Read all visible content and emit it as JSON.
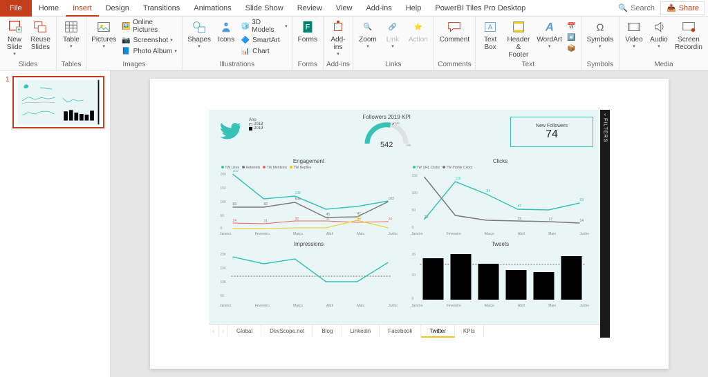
{
  "tabs": {
    "file": "File",
    "items": [
      "Home",
      "Insert",
      "Design",
      "Transitions",
      "Animations",
      "Slide Show",
      "Review",
      "View",
      "Add-ins",
      "Help",
      "PowerBI Tiles Pro Desktop"
    ],
    "active": "Insert",
    "search_placeholder": "Search",
    "share": "Share"
  },
  "ribbon": {
    "slides": {
      "label": "Slides",
      "new_slide": "New\nSlide",
      "reuse": "Reuse\nSlides"
    },
    "tables": {
      "label": "Tables",
      "table": "Table"
    },
    "images": {
      "label": "Images",
      "pictures": "Pictures",
      "online": "Online Pictures",
      "screenshot": "Screenshot",
      "photo_album": "Photo Album"
    },
    "illustrations": {
      "label": "Illustrations",
      "shapes": "Shapes",
      "icons": "Icons",
      "models": "3D Models",
      "smartart": "SmartArt",
      "chart": "Chart"
    },
    "forms": {
      "label": "Forms",
      "forms": "Forms"
    },
    "addins": {
      "label": "Add-ins",
      "btn": "Add-\nins"
    },
    "links": {
      "label": "Links",
      "zoom": "Zoom",
      "link": "Link",
      "action": "Action"
    },
    "comments": {
      "label": "Comments",
      "comment": "Comment"
    },
    "text": {
      "label": "Text",
      "textbox": "Text\nBox",
      "header": "Header\n& Footer",
      "wordart": "WordArt"
    },
    "symbols": {
      "label": "Symbols",
      "symbols": "Symbols"
    },
    "media": {
      "label": "Media",
      "video": "Video",
      "audio": "Audio",
      "screen": "Screen\nRecordin"
    }
  },
  "thumb": {
    "num": "1"
  },
  "dashboard": {
    "filters": "FILTERS",
    "legend_title": "Ano",
    "legend": [
      {
        "color": "#ffffff",
        "border": "#999",
        "label": "2018"
      },
      {
        "color": "#000000",
        "border": "#000",
        "label": "2019"
      }
    ],
    "kpi_title": "Followers 2019 KPI",
    "kpi_target": "610",
    "kpi_max": "1000",
    "kpi_value": "542",
    "new_followers_label": "New Followers",
    "new_followers_value": "74",
    "engagement": {
      "title": "Engagement",
      "legend": [
        {
          "c": "#37c2b8",
          "t": "TW Likes"
        },
        {
          "c": "#7a7a7a",
          "t": "Retweets"
        },
        {
          "c": "#e06666",
          "t": "TW Mentions"
        },
        {
          "c": "#f2c811",
          "t": "TW Replies"
        }
      ]
    },
    "clicks": {
      "title": "Clicks",
      "legend": [
        {
          "c": "#37c2b8",
          "t": "TW URL Clicks"
        },
        {
          "c": "#7a7a7a",
          "t": "TW Profile Clicks"
        }
      ]
    },
    "impressions": {
      "title": "Impressions"
    },
    "tweets": {
      "title": "Tweets"
    },
    "months": [
      "Janeiro",
      "Fevereiro",
      "Março",
      "Abril",
      "Maio",
      "Junho"
    ],
    "tabs": {
      "items": [
        "Global",
        "DevScope.net",
        "Blog",
        "Linkedin",
        "Facebook",
        "Twitter",
        "KPIs"
      ],
      "active": "Twitter"
    }
  },
  "chart_data": [
    {
      "type": "gauge",
      "title": "Followers 2019 KPI",
      "value": 542,
      "target": 610,
      "max": 1000
    },
    {
      "type": "line",
      "title": "Engagement",
      "categories": [
        "Janeiro",
        "Fevereiro",
        "Março",
        "Abril",
        "Maio",
        "Junho"
      ],
      "series": [
        {
          "name": "TW Likes",
          "values": [
            209,
            118,
            128,
            75,
            85,
            105
          ]
        },
        {
          "name": "Retweets",
          "values": [
            83,
            82,
            100,
            45,
            47,
            103
          ]
        },
        {
          "name": "TW Mentions",
          "values": [
            24,
            21,
            32,
            31,
            27,
            29
          ]
        },
        {
          "name": "TW Replies",
          "values": [
            5,
            4,
            6,
            7,
            33,
            8
          ]
        }
      ],
      "ylim": [
        0,
        200
      ]
    },
    {
      "type": "line",
      "title": "Clicks",
      "categories": [
        "Janeiro",
        "Fevereiro",
        "Março",
        "Abril",
        "Maio",
        "Junho"
      ],
      "series": [
        {
          "name": "TW URL Clicks",
          "values": [
            23,
            115,
            84,
            47,
            46,
            63
          ]
        },
        {
          "name": "TW Profile Clicks",
          "values": [
            126,
            32,
            20,
            19,
            17,
            14
          ]
        }
      ],
      "ylim": [
        0,
        150
      ]
    },
    {
      "type": "line",
      "title": "Impressions",
      "categories": [
        "Janeiro",
        "Fevereiro",
        "Março",
        "Abril",
        "Maio",
        "Junho"
      ],
      "series": [
        {
          "name": "Impressions",
          "values": [
            21000,
            18000,
            20000,
            11000,
            11000,
            19000
          ]
        }
      ],
      "ylim": [
        0,
        23000
      ],
      "reference_line": 11600
    },
    {
      "type": "bar",
      "title": "Tweets",
      "categories": [
        "Janeiro",
        "Fevereiro",
        "Março",
        "Abril",
        "Maio",
        "Junho"
      ],
      "values": [
        21,
        23,
        18,
        15,
        14,
        22
      ],
      "ylim": [
        0,
        26
      ],
      "reference_line": 18.8
    }
  ]
}
